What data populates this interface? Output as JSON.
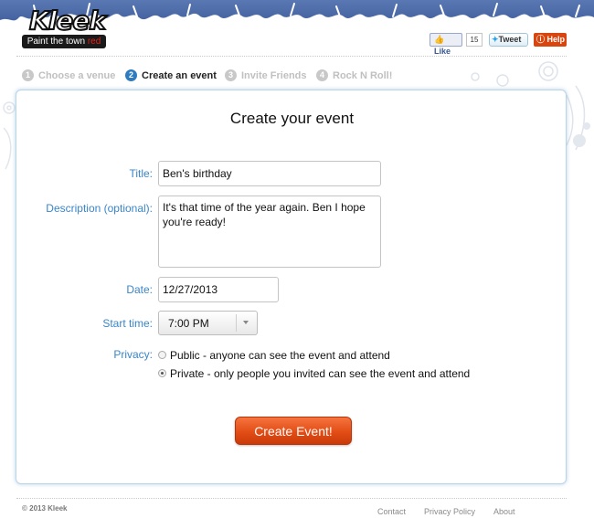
{
  "brand": {
    "logo_text": "Kleek",
    "tagline_main": "Paint the town",
    "tagline_accent": "red"
  },
  "social": {
    "like_label": "Like",
    "like_count": "15",
    "tweet_label": "Tweet",
    "help_label": "Help"
  },
  "steps": [
    {
      "num": "1",
      "label": "Choose a venue",
      "active": false
    },
    {
      "num": "2",
      "label": "Create an event",
      "active": true
    },
    {
      "num": "3",
      "label": "Invite Friends",
      "active": false
    },
    {
      "num": "4",
      "label": "Rock N Roll!",
      "active": false
    }
  ],
  "form": {
    "heading": "Create your event",
    "title_label": "Title:",
    "title_value": "Ben's birthday",
    "description_label": "Description (optional):",
    "description_value": "It's that time of the year again. Ben I hope you're ready!",
    "date_label": "Date:",
    "date_value": "12/27/2013",
    "start_time_label": "Start time:",
    "start_time_value": "7:00 PM",
    "privacy_label": "Privacy:",
    "privacy_public": "Public - anyone can see the event and attend",
    "privacy_private": "Private - only people you invited can see the event and attend",
    "privacy_selected": "private",
    "submit_label": "Create Event!"
  },
  "footer": {
    "copyright": "© 2013 Kleek",
    "links": [
      "Contact",
      "Privacy Policy",
      "About"
    ]
  },
  "colors": {
    "banner": "#3d5c9b",
    "label_blue": "#3a86c8",
    "active_step": "#2f7bbf",
    "submit_orange": "#e34d16"
  }
}
